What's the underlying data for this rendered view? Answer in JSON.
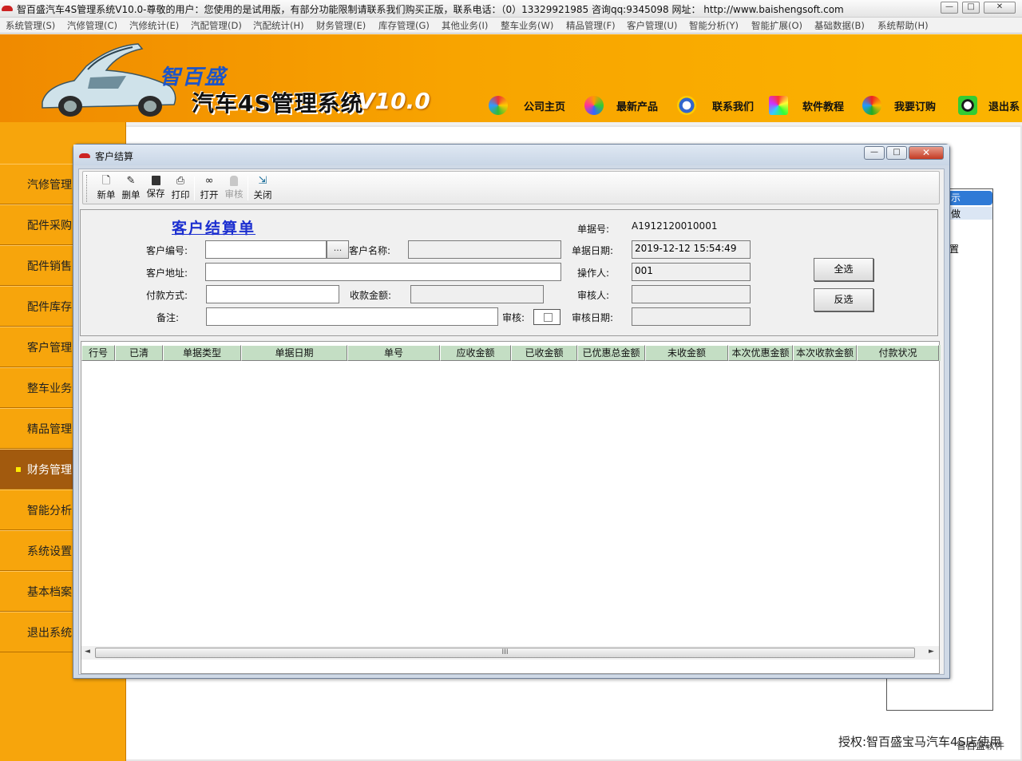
{
  "window": {
    "title": "智百盛汽车4S管理系统V10.0-尊敬的用户：您使用的是试用版，有部分功能限制请联系我们购买正版，联系电话：（0）13329921985  咨询qq:9345098   网址：  http://www.baishengsoft.com",
    "min": "—",
    "max": "□",
    "close": "✕"
  },
  "menu": [
    "系统管理(S)",
    "汽修管理(C)",
    "汽修统计(E)",
    "汽配管理(D)",
    "汽配统计(H)",
    "财务管理(E)",
    "库存管理(G)",
    "其他业务(I)",
    "整车业务(W)",
    "精品管理(F)",
    "客户管理(U)",
    "智能分析(Y)",
    "智能扩展(O)",
    "基础数据(B)",
    "系统帮助(H)"
  ],
  "banner": {
    "brand_cn": "智百盛",
    "product": "汽车4S管理系统",
    "version": "V10.0",
    "links": [
      "公司主页",
      "最新产品",
      "联系我们",
      "软件教程",
      "我要订购",
      "退出系"
    ]
  },
  "sidebar": {
    "items": [
      "汽修管理",
      "配件采购",
      "配件销售",
      "配件库存",
      "客户管理",
      "整车业务",
      "精品管理",
      "财务管理",
      "智能分析",
      "系统设置",
      "基本档案",
      "退出系统"
    ],
    "active_index": 7
  },
  "right_panel": {
    "item1": "示",
    "item2": "做",
    "item3": "置"
  },
  "footer": {
    "text1": "授权:智百盛宝马汽车4S店使用",
    "text2": "智百盛软件"
  },
  "dialog": {
    "title": "客户结算",
    "toolbar": {
      "new": "新单",
      "delete": "删单",
      "save": "保存",
      "print": "打印",
      "open": "打开",
      "audit": "审核",
      "close": "关闭"
    },
    "form": {
      "heading": "客户结算单",
      "bill_no_label": "单据号:",
      "bill_no": "A1912120010001",
      "customer_no_label": "客户编号:",
      "customer_no": "",
      "browse": "...",
      "customer_name_label": "客户名称:",
      "customer_name": "",
      "bill_date_label": "单据日期:",
      "bill_date": "2019-12-12 15:54:49",
      "address_label": "客户地址:",
      "address": "",
      "operator_label": "操作人:",
      "operator": "001",
      "payment_label": "付款方式:",
      "payment": "",
      "amount_label": "收款金额:",
      "amount": "",
      "auditor_label": "审核人:",
      "auditor": "",
      "remark_label": "备注:",
      "remark": "",
      "audit_label": "审核:",
      "audit_date_label": "审核日期:",
      "audit_date": "",
      "select_all": "全选",
      "invert": "反选"
    },
    "grid": {
      "columns": [
        "行号",
        "已清",
        "单据类型",
        "单据日期",
        "单号",
        "应收金额",
        "已收金额",
        "已优惠总金额",
        "未收金额",
        "本次优惠金额",
        "本次收款金额",
        "付款状况"
      ],
      "scroll_grip": "III"
    }
  }
}
